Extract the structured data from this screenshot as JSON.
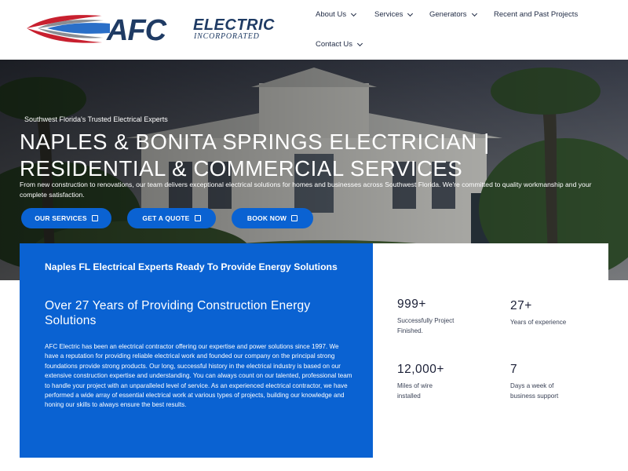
{
  "header": {
    "logo": {
      "wordmark": "AFC",
      "brand_line1": "ELECTRIC",
      "brand_line2": "INCORPORATED"
    },
    "nav": [
      {
        "label": "About Us",
        "has_dropdown": true
      },
      {
        "label": "Services",
        "has_dropdown": true
      },
      {
        "label": "Generators",
        "has_dropdown": true
      },
      {
        "label": "Recent and Past Projects",
        "has_dropdown": false
      },
      {
        "label": "Contact Us",
        "has_dropdown": true
      }
    ]
  },
  "hero": {
    "eyebrow": "Southwest Florida's Trusted Electrical Experts",
    "title": "NAPLES & BONITA SPRINGS ELECTRICIAN | RESIDENTIAL & COMMERCIAL SERVICES",
    "description": "From new construction to renovations, our team delivers exceptional electrical solutions for homes and businesses across Southwest Florida. We're committed to quality workmanship and your complete satisfaction.",
    "buttons": [
      {
        "label": "OUR SERVICES",
        "icon": "document-icon"
      },
      {
        "label": "GET A QUOTE",
        "icon": "message-icon"
      },
      {
        "label": "BOOK NOW",
        "icon": "calendar-icon"
      }
    ]
  },
  "about": {
    "heading": "Naples FL Electrical Experts Ready To Provide Energy Solutions",
    "subheading": "Over 27 Years of Providing Construction Energy Solutions",
    "body": "AFC Electric has been an electrical contractor offering our expertise and power solutions since 1997. We have a reputation for providing reliable electrical work and founded our company on the principal strong foundations provide strong products. Our long, successful history in the electrical industry is based on our extensive construction expertise and understanding. You can always count on our talented, professional team to handle your project with an unparalleled level of service. As an experienced electrical contractor, we have performed a wide array of essential electrical work at various types of projects, building our knowledge and honing our skills to always ensure the best results."
  },
  "stats": [
    {
      "value": "999+",
      "label": "Successfully Project Finished."
    },
    {
      "value": "27+",
      "label": "Years of experience"
    },
    {
      "value": "12,000+",
      "label": "Miles of wire installed"
    },
    {
      "value": "7",
      "label": "Days a week of business support"
    }
  ],
  "colors": {
    "brand_blue": "#0a62d2",
    "logo_red": "#c8202f",
    "logo_gray": "#8a8d93",
    "logo_navy": "#1f3b64",
    "nav_text": "#1f2a44",
    "stat_text": "#1a1f36"
  }
}
